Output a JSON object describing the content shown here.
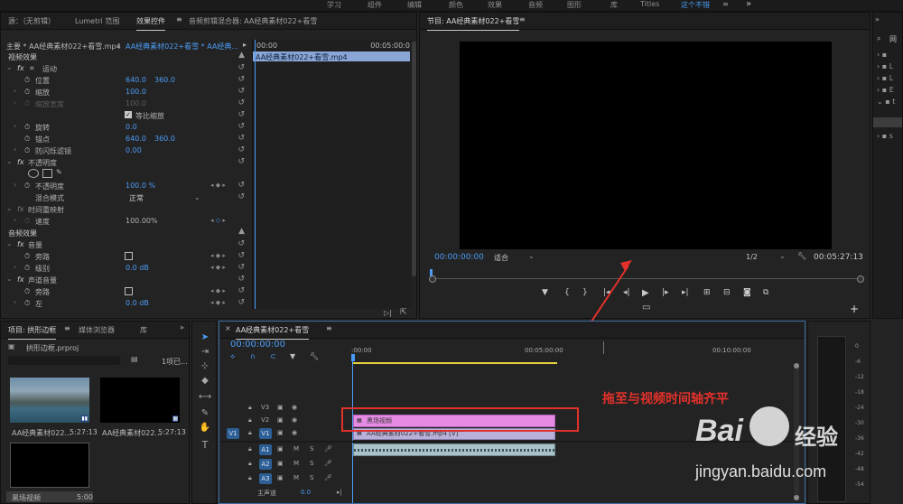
{
  "top_tabs": [
    "学习",
    "组件",
    "编辑",
    "颜色",
    "效果",
    "音频",
    "图形",
    "库",
    "Titles",
    "这个不错"
  ],
  "top_overflow": "»",
  "effect_panel": {
    "tabs": [
      "源：（无剪辑）",
      "Lumetri 范围",
      "效果控件",
      "音频剪辑混合器: AA经典素材022+看雪"
    ],
    "active_tab": "效果控件",
    "source_label": "主要 * AA经典素材022+看雪.mp4",
    "sequence_label": "AA经典素材022+看雪 * AA经典...",
    "timecode_start": "00:00",
    "timecode_end": "00:05:00:0",
    "clip_label": "AA经典素材022+看雪.mp4",
    "video_effects_header": "视频效果",
    "motion": "运动",
    "position_label": "位置",
    "position_x": "640.0",
    "position_y": "360.0",
    "scale_label": "缩放",
    "scale_value": "100.0",
    "scale_width_label": "缩放宽度",
    "scale_width_value": "100.0",
    "uniform_scale_label": "等比缩放",
    "rotation_label": "旋转",
    "rotation_value": "0.0",
    "anchor_label": "锚点",
    "anchor_x": "640.0",
    "anchor_y": "360.0",
    "antiflicker_label": "防闪烁滤镜",
    "antiflicker_value": "0.00",
    "opacity_section": "不透明度",
    "opacity_label": "不透明度",
    "opacity_value": "100.0 %",
    "blend_label": "混合模式",
    "blend_value": "正常",
    "time_remap_section": "时间重映射",
    "speed_label": "速度",
    "speed_value": "100.00%",
    "audio_effects_header": "音频效果",
    "volume_section": "音量",
    "bypass_label": "旁路",
    "level_label": "级别",
    "level_value": "0.0 dB",
    "channel_volume_section": "声道音量",
    "bypass_label_2": "旁路",
    "left_label": "左",
    "left_value": "0.0 dB"
  },
  "program_monitor": {
    "title": "节目: AA经典素材022+看雪",
    "timecode": "00:00:00:00",
    "fit_label": "适合",
    "resolution": "1/2",
    "duration": "00:05:27:13"
  },
  "right_panel": {
    "title": "网",
    "letters": [
      "L",
      "L",
      "E",
      "t",
      "s"
    ]
  },
  "project_panel": {
    "tabs": [
      "项目: 拱形边框",
      "媒体浏览器",
      "库"
    ],
    "project_file": "拱形边框.prproj",
    "item_count": "1项已...",
    "items": [
      {
        "name": "AA经典素材022...",
        "duration": "5:27:13"
      },
      {
        "name": "AA经典素材022...",
        "duration": "5:27:13"
      },
      {
        "name": "黑场视频",
        "duration": "5:00"
      }
    ]
  },
  "timeline": {
    "tab": "AA经典素材022+看雪",
    "timecode": "00:00:00:00",
    "ruler_labels": [
      ":00:00",
      "00:05:00:00",
      "00:10:00:00"
    ],
    "tracks": [
      {
        "src": "",
        "name": "V3"
      },
      {
        "src": "",
        "name": "V2"
      },
      {
        "src": "V1",
        "name": "V1"
      },
      {
        "src": "A1",
        "name": "A1"
      },
      {
        "src": "A2",
        "name": "A2"
      },
      {
        "src": "A3",
        "name": "A3"
      }
    ],
    "master_label": "主声道",
    "master_value": "0.0",
    "clip_v2": "黑场视频",
    "clip_v1": "AA经典素材022+看雪.mp4 [V]",
    "mute_label": "M",
    "solo_label": "S"
  },
  "annotation": {
    "text": "拖至与视频时间轴齐平"
  },
  "meter_scale": [
    "0",
    "-6",
    "-12",
    "-18",
    "-24",
    "-30",
    "-36",
    "-42",
    "-48",
    "-54"
  ],
  "watermark": {
    "brand": "Bai",
    "brand2": "经验",
    "url": "jingyan.baidu.com"
  },
  "colors": {
    "accent_blue": "#4b9cf5",
    "clip_pink": "#e58be3",
    "annotation_red": "#e2312b",
    "audio_clip": "#a9c1c9"
  }
}
